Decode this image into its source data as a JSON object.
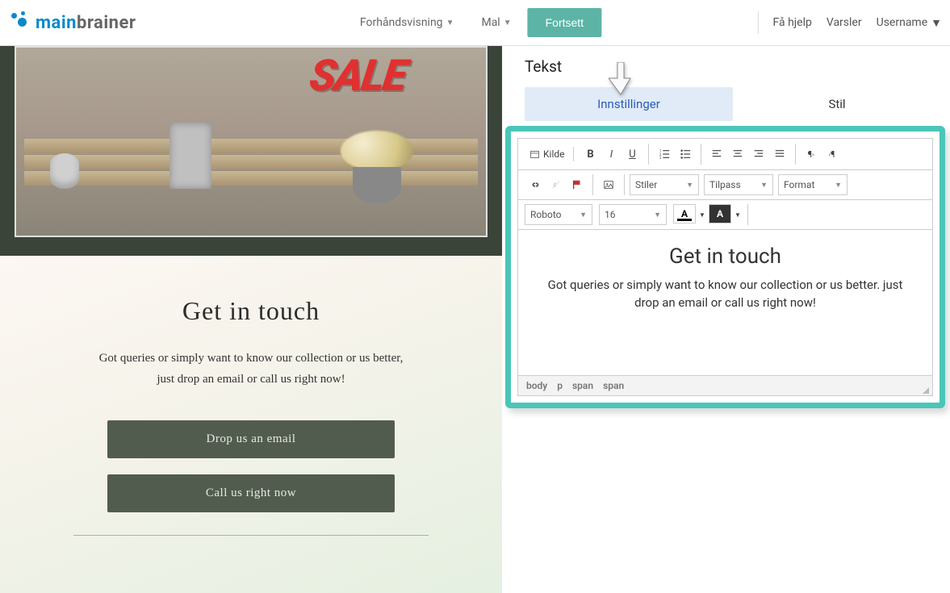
{
  "brand": {
    "name_part1": "main",
    "name_part2": "brainer"
  },
  "nav": {
    "preview": "Forhåndsvisning",
    "template": "Mal",
    "continue": "Fortsett",
    "help": "Få hjelp",
    "alerts": "Varsler",
    "username": "Username"
  },
  "preview": {
    "sale_text": "SALE",
    "contact_title": "Get in touch",
    "contact_desc_l1": "Got queries or simply want to know our collection or us better,",
    "contact_desc_l2": "just drop an email or call us right now!",
    "btn_email": "Drop us an email",
    "btn_call": "Call us right now"
  },
  "side": {
    "title": "Tekst",
    "tab_settings": "Innstillinger",
    "tab_style": "Stil"
  },
  "editor": {
    "source": "Kilde",
    "styles": "Stiler",
    "fit": "Tilpass",
    "format": "Format",
    "font": "Roboto",
    "size": "16",
    "content_title": "Get in touch",
    "content_body": "Got queries or simply want to know our collection or us better. just drop an email or call us right now!",
    "path": [
      "body",
      "p",
      "span",
      "span"
    ]
  }
}
